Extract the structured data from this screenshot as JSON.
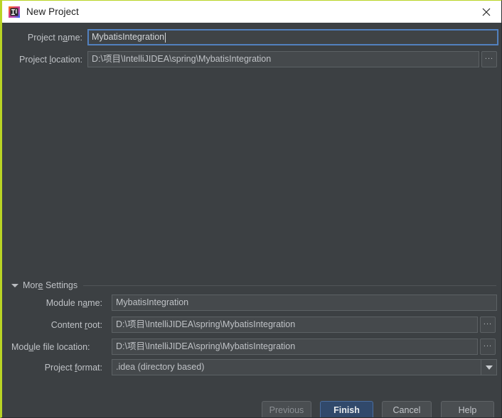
{
  "window": {
    "title": "New Project",
    "app_icon": "intellij-idea-icon",
    "close_icon": "close-icon",
    "accent_color": "#b9d425",
    "background_color": "#3c4043",
    "titlebar_color": "#ffffff"
  },
  "form": {
    "project_name": {
      "label_before": "Project n",
      "label_mnemonic": "a",
      "label_after": "me:",
      "value": "MybatisIntegration",
      "focused": true
    },
    "project_location": {
      "label_before": "Project ",
      "label_mnemonic": "l",
      "label_after": "ocation:",
      "value": "D:\\项目\\IntelliJIDEA\\spring\\MybatisIntegration",
      "browse_label": "...",
      "browse_icon": "ellipsis-browse-icon"
    }
  },
  "more_settings": {
    "label_before": "Mor",
    "label_mnemonic": "e",
    "label_after": " Settings",
    "expanded": true,
    "expand_icon": "triangle-down-icon",
    "module_name": {
      "label_before": "Module n",
      "label_mnemonic": "a",
      "label_after": "me:",
      "value": "MybatisIntegration"
    },
    "content_root": {
      "label_before": "Content ",
      "label_mnemonic": "r",
      "label_after": "oot:",
      "value": "D:\\项目\\IntelliJIDEA\\spring\\MybatisIntegration",
      "browse_label": "...",
      "browse_icon": "ellipsis-browse-icon"
    },
    "module_file_location": {
      "label_before": "Mod",
      "label_mnemonic": "u",
      "label_after": "le file location:",
      "value": "D:\\项目\\IntelliJIDEA\\spring\\MybatisIntegration",
      "browse_label": "...",
      "browse_icon": "ellipsis-browse-icon"
    },
    "project_format": {
      "label_before": "Project ",
      "label_mnemonic": "f",
      "label_after": "ormat:",
      "value": ".idea (directory based)",
      "dropdown_icon": "chevron-down-icon"
    }
  },
  "buttons": {
    "previous": "Previous",
    "finish": "Finish",
    "cancel": "Cancel",
    "help": "Help"
  }
}
